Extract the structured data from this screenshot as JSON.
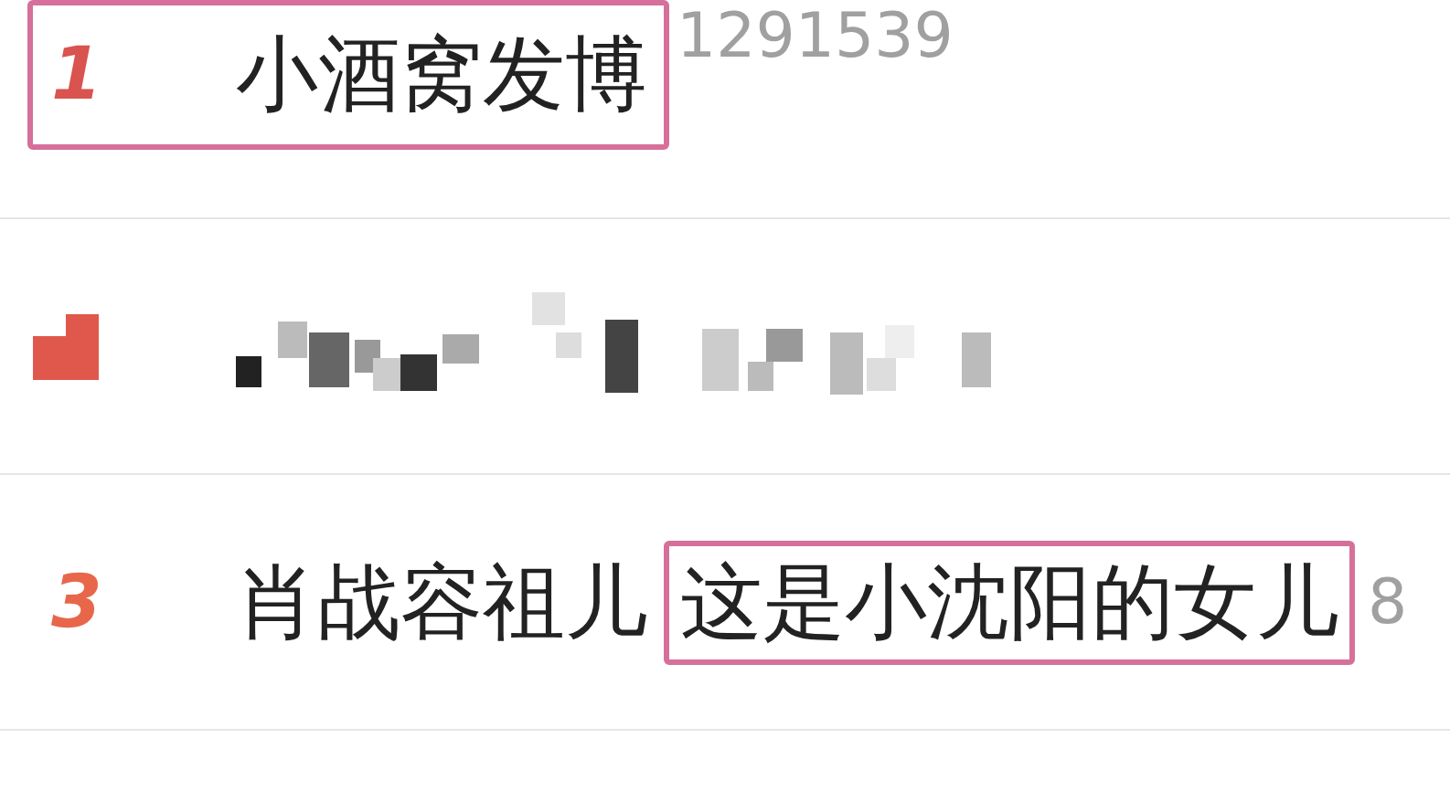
{
  "hot_list": [
    {
      "kind": "plain",
      "rank": "1",
      "color": "#d9534f",
      "rank_highlighted": true,
      "title": [
        {
          "text": "小酒窝发博"
        }
      ],
      "count": "1291539"
    },
    {
      "kind": "mosaic",
      "color": "#e0584c"
    },
    {
      "kind": "plain",
      "rank": "3",
      "color": "#e8674a",
      "rank_highlighted": false,
      "title": [
        {
          "text": "肖战容祖儿",
          "highlighted": false
        },
        {
          "text": "这是小沈阳的女儿",
          "highlighted": true
        }
      ],
      "count": "8"
    }
  ]
}
